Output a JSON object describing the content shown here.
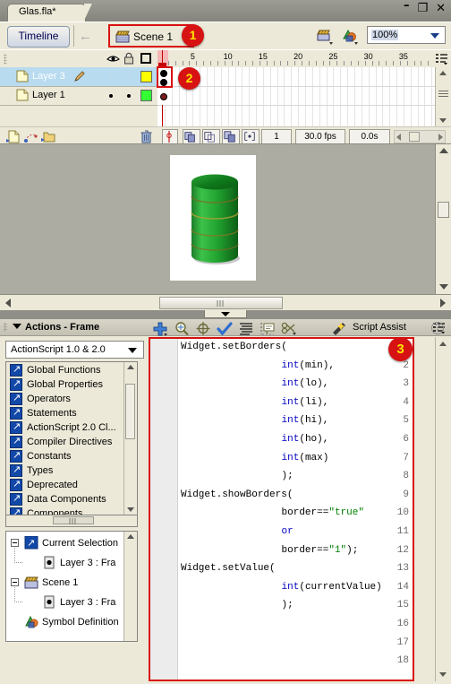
{
  "window": {
    "document_tab": "Glas.fla*",
    "minimize_label": "–",
    "restore_label": "❐",
    "close_label": "✕"
  },
  "scenebar": {
    "timeline_button": "Timeline",
    "back_arrow": "←",
    "scene_label": "Scene 1",
    "badge": "1",
    "zoom_value": "100%"
  },
  "timeline": {
    "layers": [
      {
        "name": "Layer 3",
        "selected": true,
        "color": "#ffff00"
      },
      {
        "name": "Layer 1",
        "selected": false,
        "color": "#33ff33"
      }
    ],
    "ruler_ticks": [
      "1",
      "5",
      "10",
      "15",
      "20",
      "25",
      "30",
      "35"
    ],
    "badge": "2",
    "status": {
      "current_frame": "1",
      "fps": "30.0 fps",
      "elapsed": "0.0s"
    }
  },
  "actions": {
    "panel_title": "Actions - Frame",
    "version_select": "ActionScript 1.0 & 2.0",
    "script_assist_label": "Script Assist",
    "help_icon": "?",
    "badge": "3",
    "category_tree": [
      "Global Functions",
      "Global Properties",
      "Operators",
      "Statements",
      "ActionScript 2.0 Cl...",
      "Compiler Directives",
      "Constants",
      "Types",
      "Deprecated",
      "Data Components",
      "Components"
    ],
    "navigator_tree": [
      {
        "label": "Current Selection",
        "icon": "arrow-icon",
        "indent": 0,
        "expander": true
      },
      {
        "label": "Layer 3 : Fra",
        "icon": "frame-icon",
        "indent": 1,
        "expander": false
      },
      {
        "label": "Scene 1",
        "icon": "scene-icon",
        "indent": 0,
        "expander": true
      },
      {
        "label": "Layer 3 : Fra",
        "icon": "frame-icon",
        "indent": 1,
        "expander": false
      },
      {
        "label": "Symbol Definition",
        "icon": "symbol-icon",
        "indent": 0,
        "expander": false
      }
    ],
    "code": [
      {
        "n": "1",
        "indent": 0,
        "tokens": [
          {
            "t": "Widget.setBorders(",
            "c": "plain"
          }
        ]
      },
      {
        "n": "2",
        "indent": 17,
        "tokens": [
          {
            "t": "int",
            "c": "kw"
          },
          {
            "t": "(min),",
            "c": "plain"
          }
        ]
      },
      {
        "n": "3",
        "indent": 17,
        "tokens": [
          {
            "t": "int",
            "c": "kw"
          },
          {
            "t": "(lo),",
            "c": "plain"
          }
        ]
      },
      {
        "n": "4",
        "indent": 17,
        "tokens": [
          {
            "t": "int",
            "c": "kw"
          },
          {
            "t": "(li),",
            "c": "plain"
          }
        ]
      },
      {
        "n": "5",
        "indent": 17,
        "tokens": [
          {
            "t": "int",
            "c": "kw"
          },
          {
            "t": "(hi),",
            "c": "plain"
          }
        ]
      },
      {
        "n": "6",
        "indent": 17,
        "tokens": [
          {
            "t": "int",
            "c": "kw"
          },
          {
            "t": "(ho),",
            "c": "plain"
          }
        ]
      },
      {
        "n": "7",
        "indent": 17,
        "tokens": [
          {
            "t": "int",
            "c": "kw"
          },
          {
            "t": "(max)",
            "c": "plain"
          }
        ]
      },
      {
        "n": "8",
        "indent": 17,
        "tokens": [
          {
            "t": ");",
            "c": "plain"
          }
        ]
      },
      {
        "n": "9",
        "indent": 0,
        "tokens": [
          {
            "t": "Widget.showBorders(",
            "c": "plain"
          }
        ]
      },
      {
        "n": "10",
        "indent": 17,
        "tokens": [
          {
            "t": "border==",
            "c": "plain"
          },
          {
            "t": "\"true\"",
            "c": "str"
          }
        ]
      },
      {
        "n": "11",
        "indent": 17,
        "tokens": [
          {
            "t": "or",
            "c": "kw"
          }
        ]
      },
      {
        "n": "12",
        "indent": 17,
        "tokens": [
          {
            "t": "border==",
            "c": "plain"
          },
          {
            "t": "\"1\"",
            "c": "str"
          },
          {
            "t": ");",
            "c": "plain"
          }
        ]
      },
      {
        "n": "13",
        "indent": 0,
        "tokens": [
          {
            "t": "Widget.setValue(",
            "c": "plain"
          }
        ]
      },
      {
        "n": "14",
        "indent": 17,
        "tokens": [
          {
            "t": "int",
            "c": "kw"
          },
          {
            "t": "(currentValue)",
            "c": "plain"
          }
        ]
      },
      {
        "n": "15",
        "indent": 17,
        "tokens": [
          {
            "t": ");",
            "c": "plain"
          }
        ]
      },
      {
        "n": "16",
        "indent": 0,
        "tokens": []
      },
      {
        "n": "17",
        "indent": 0,
        "tokens": []
      },
      {
        "n": "18",
        "indent": 0,
        "tokens": []
      }
    ]
  },
  "colors": {
    "badge_bg": "#d71212",
    "badge_fg": "#ffe400",
    "highlight_border": "#d81111",
    "keyword": "#0000c0",
    "string": "#008000",
    "cylinder_green": "#1f9c2f"
  }
}
